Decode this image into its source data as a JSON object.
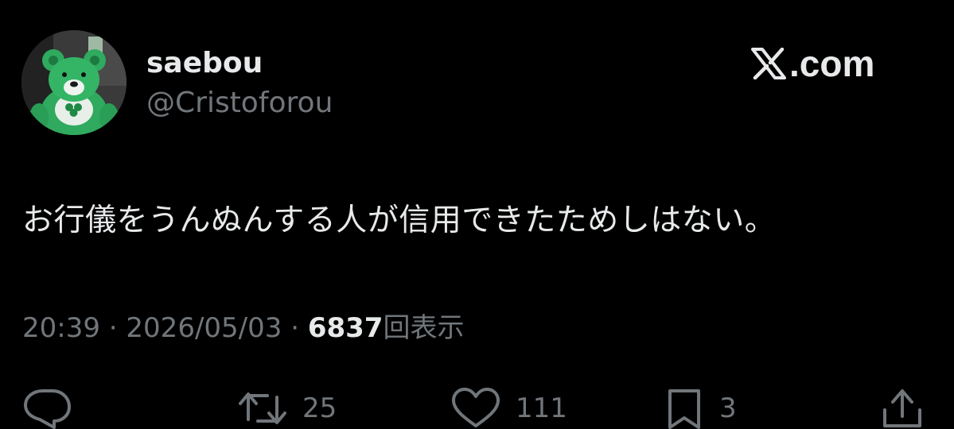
{
  "author": {
    "display_name": "saebou",
    "handle": "@Cristoforou",
    "avatar": "green-teddy-bear-with-shamrock-avatar"
  },
  "brand": {
    "icon": "x-logo-icon",
    "text": ".com"
  },
  "tweet": {
    "text": "お行儀をうんぬんする人が信用できたためしはない。"
  },
  "meta": {
    "time": "20:39",
    "separator": "·",
    "date": "2026/05/03",
    "views_count": "6837",
    "views_label": "回表示"
  },
  "actions": {
    "reply": {
      "icon": "reply-icon"
    },
    "repost": {
      "icon": "repost-icon",
      "count": "25"
    },
    "like": {
      "icon": "heart-icon",
      "count": "111"
    },
    "bookmark": {
      "icon": "bookmark-icon",
      "count": "3"
    },
    "share": {
      "icon": "share-icon"
    }
  },
  "colors": {
    "background": "#000000",
    "primary_text": "#e7e9ea",
    "secondary_text": "#71767b"
  }
}
